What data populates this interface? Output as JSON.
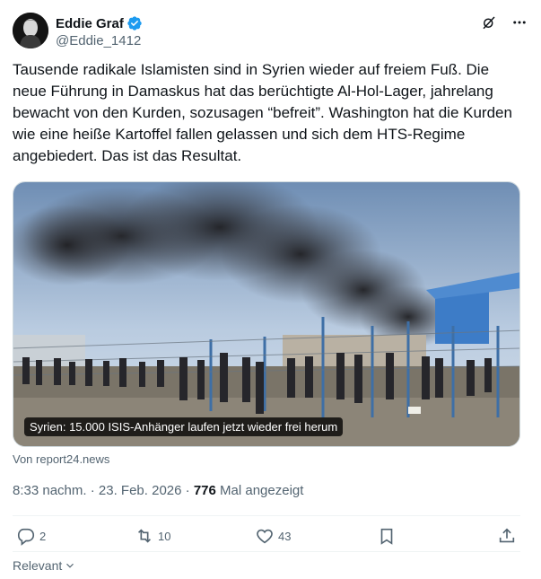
{
  "author": {
    "name": "Eddie Graf",
    "handle": "@Eddie_1412",
    "verified": true
  },
  "tweet": {
    "text": "Tausende radikale Islamisten sind in Syrien wieder auf freiem Fuß. Die neue Führung in Damaskus hat das berüchtigte Al-Hol-Lager, jahrelang bewacht von den Kurden, sozusagen “befreit”. Washington hat die Kurden wie eine heiße Kartoffel fallen gelassen und sich dem HTS-Regime angebiedert. Das ist das Resultat.",
    "media_caption": "Syrien: 15.000 ISIS-Anhänger laufen jetzt wieder frei herum",
    "source": "Von report24.news",
    "time": "8:33 nachm.",
    "date": "23. Feb. 2026",
    "views": "776",
    "views_label": "Mal angezeigt"
  },
  "actions": {
    "replies": "2",
    "reposts": "10",
    "likes": "43"
  },
  "footer": {
    "sort_label": "Relevant"
  },
  "colors": {
    "text": "#0f1419",
    "secondary": "#536471",
    "verified": "#1d9bf0",
    "border": "#eff3f4"
  },
  "icons": [
    "verified-badge-icon",
    "grok-icon",
    "more-icon",
    "reply-icon",
    "repost-icon",
    "like-icon",
    "bookmark-icon",
    "share-icon",
    "chevron-down-icon"
  ]
}
